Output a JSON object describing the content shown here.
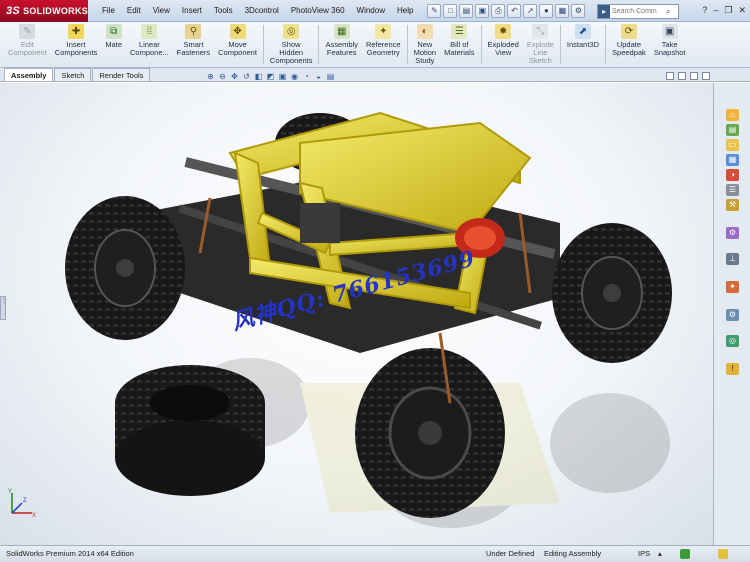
{
  "app": {
    "brand_prefix": "3S",
    "brand": "SOLIDWORKS"
  },
  "menu": [
    "File",
    "Edit",
    "View",
    "Insert",
    "Tools",
    "3Dcontrol",
    "PhotoView 360",
    "Window",
    "Help"
  ],
  "search": {
    "placeholder": "Search Comm"
  },
  "command_manager": [
    {
      "label": "Edit\nComponent",
      "icon": "edit-component-icon",
      "enabled": false
    },
    {
      "label": "Insert\nComponents",
      "icon": "insert-components-icon",
      "enabled": true
    },
    {
      "label": "Mate",
      "icon": "mate-icon",
      "enabled": true
    },
    {
      "label": "Linear\nCompone...",
      "icon": "linear-pattern-icon",
      "enabled": true
    },
    {
      "label": "Smart\nFasteners",
      "icon": "smart-fasteners-icon",
      "enabled": true
    },
    {
      "label": "Move\nComponent",
      "icon": "move-component-icon",
      "enabled": true
    },
    {
      "label": "Show\nHidden\nComponents",
      "icon": "show-hidden-icon",
      "enabled": true
    },
    {
      "label": "Assembly\nFeatures",
      "icon": "assembly-features-icon",
      "enabled": true
    },
    {
      "label": "Reference\nGeometry",
      "icon": "reference-geometry-icon",
      "enabled": true
    },
    {
      "label": "New\nMotion\nStudy",
      "icon": "motion-study-icon",
      "enabled": true
    },
    {
      "label": "Bill of\nMaterials",
      "icon": "bom-icon",
      "enabled": true
    },
    {
      "label": "Exploded\nView",
      "icon": "exploded-view-icon",
      "enabled": true
    },
    {
      "label": "Explode\nLine\nSketch",
      "icon": "explode-line-icon",
      "enabled": false
    },
    {
      "label": "Instant3D",
      "icon": "instant3d-icon",
      "enabled": true
    },
    {
      "label": "Update\nSpeedpak",
      "icon": "speedpak-icon",
      "enabled": true
    },
    {
      "label": "Take\nSnapshot",
      "icon": "snapshot-icon",
      "enabled": true
    }
  ],
  "tabs": [
    {
      "label": "Assembly",
      "active": true
    },
    {
      "label": "Sketch",
      "active": false
    },
    {
      "label": "Render Tools",
      "active": false
    }
  ],
  "viewport": {
    "watermark": "风神QQ: 766153699",
    "model": "rock-crawler-rc-truck",
    "colors": {
      "frame": "#e8d82a",
      "tire": "#1c1c1c",
      "body_red": "#c42a1a"
    }
  },
  "status": {
    "edition": "SolidWorks Premium 2014 x64 Edition",
    "definition": "Under Defined",
    "mode": "Editing Assembly",
    "units": "IPS"
  }
}
